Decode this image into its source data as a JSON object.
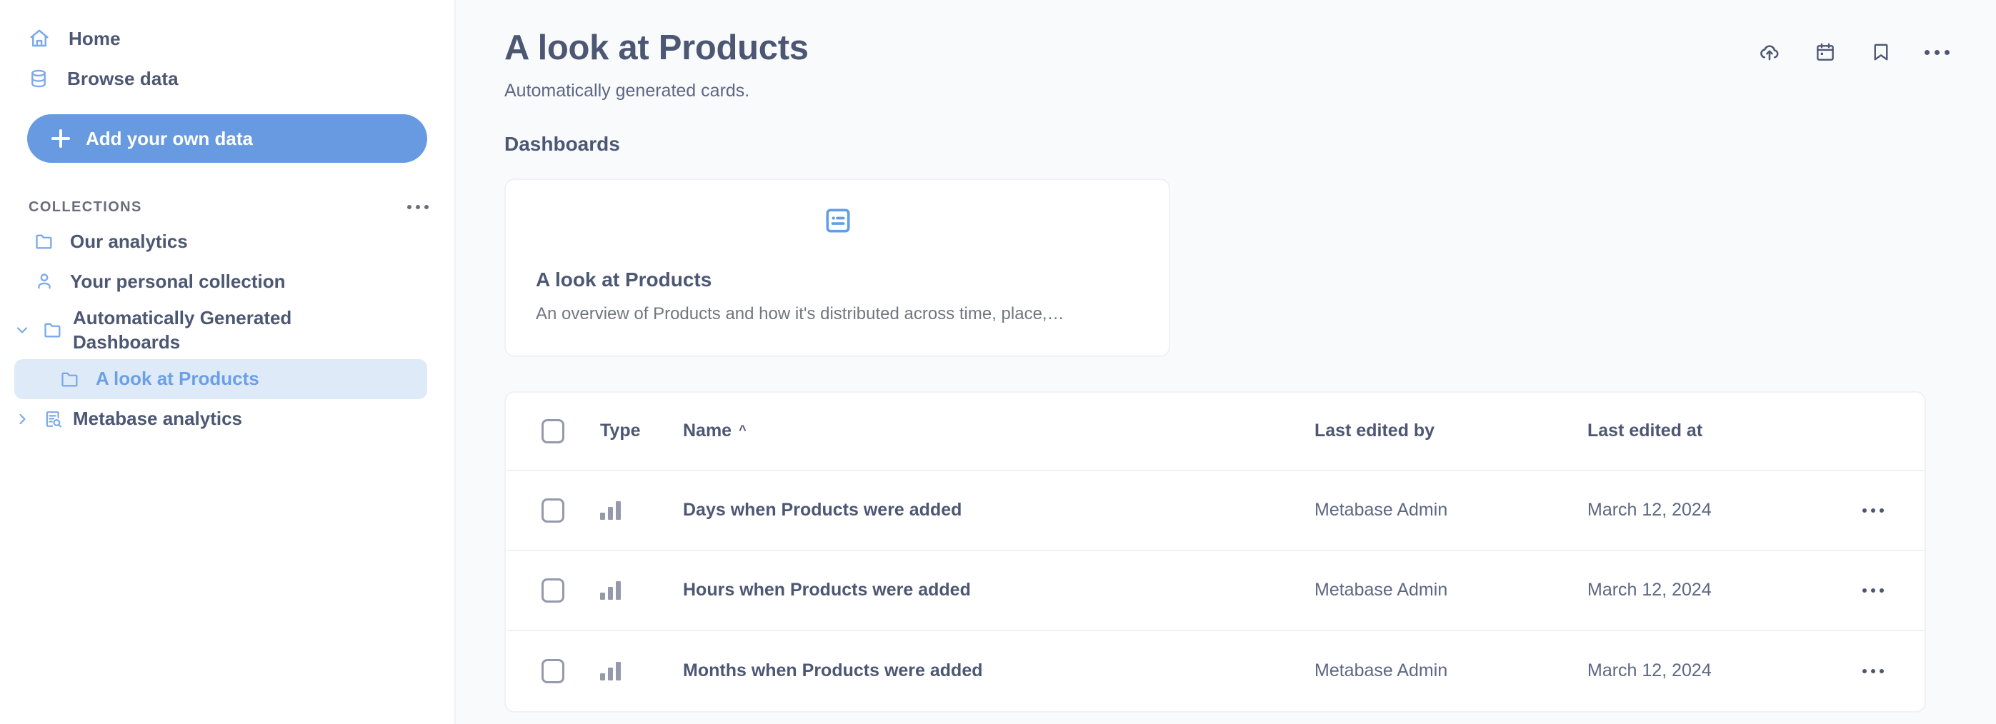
{
  "sidebar": {
    "nav": [
      {
        "label": "Home",
        "icon": "home-icon"
      },
      {
        "label": "Browse data",
        "icon": "database-icon"
      }
    ],
    "cta": {
      "label": "Add your own data",
      "icon": "plus-icon",
      "color": "#679ae1"
    },
    "collections_header": {
      "title": "COLLECTIONS",
      "menu_icon": "ellipsis-icon"
    },
    "collections": [
      {
        "label": "Our analytics",
        "icon": "folder-icon",
        "selected": false,
        "chevron": "none"
      },
      {
        "label": "Your personal collection",
        "icon": "person-icon",
        "selected": false,
        "chevron": "none"
      },
      {
        "label": "Automatically Generated Dashboards",
        "icon": "folder-icon",
        "selected": false,
        "chevron": "down"
      },
      {
        "label": "A look at Products",
        "icon": "folder-icon",
        "selected": true,
        "chevron": "none"
      },
      {
        "label": "Metabase analytics",
        "icon": "document-search-icon",
        "selected": false,
        "chevron": "right"
      }
    ],
    "selected_bg": "#dfeaf9",
    "accent": "#679ae1"
  },
  "header": {
    "title": "A look at Products",
    "subtitle": "Automatically generated cards.",
    "actions": [
      {
        "name": "upload-to-cloud-icon",
        "tooltip": "Upload"
      },
      {
        "name": "calendar-icon",
        "tooltip": "Events"
      },
      {
        "name": "bookmark-icon",
        "tooltip": "Bookmark"
      },
      {
        "name": "ellipsis-icon",
        "tooltip": "More"
      }
    ]
  },
  "dashboards_section": {
    "title": "Dashboards",
    "cards": [
      {
        "icon": "dashboard-icon",
        "title": "A look at Products",
        "description": "An overview of Products and how it's distributed across time, place,…"
      }
    ]
  },
  "table": {
    "select_all_checkbox": false,
    "columns": [
      {
        "key": "type",
        "label": "Type",
        "sort": "none"
      },
      {
        "key": "name",
        "label": "Name",
        "sort": "asc",
        "sort_glyph": "^"
      },
      {
        "key": "last_edited_by",
        "label": "Last edited by",
        "sort": "none"
      },
      {
        "key": "last_edited_at",
        "label": "Last edited at",
        "sort": "none"
      }
    ],
    "rows": [
      {
        "checked": false,
        "type_icon": "bar-chart-icon",
        "name": "Days when Products were added",
        "last_edited_by": "Metabase Admin",
        "last_edited_at": "March 12, 2024",
        "menu_icon": "ellipsis-icon"
      },
      {
        "checked": false,
        "type_icon": "bar-chart-icon",
        "name": "Hours when Products were added",
        "last_edited_by": "Metabase Admin",
        "last_edited_at": "March 12, 2024",
        "menu_icon": "ellipsis-icon"
      },
      {
        "checked": false,
        "type_icon": "bar-chart-icon",
        "name": "Months when Products were added",
        "last_edited_by": "Metabase Admin",
        "last_edited_at": "March 12, 2024",
        "menu_icon": "ellipsis-icon"
      }
    ]
  }
}
